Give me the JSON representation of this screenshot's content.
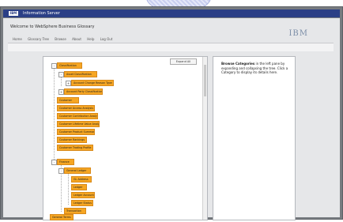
{
  "window": {
    "title": "Information Server",
    "logo": "IBM"
  },
  "header": {
    "welcome": "Welcome to WebSphere Business Glossary",
    "brand": "IBM"
  },
  "nav": {
    "items": [
      "Home",
      "Glossary Tree",
      "Browse",
      "About",
      "Help",
      "Log Out"
    ]
  },
  "tree": {
    "expand_all_label": "Expand All",
    "nodes": [
      {
        "label": "Classification",
        "expander": "-"
      },
      {
        "label": "Asset Classification",
        "expander": "-"
      },
      {
        "label": "Account Change Reason Type",
        "expander": "+"
      },
      {
        "label": "Account Party Classification",
        "expander": "+"
      },
      {
        "label": "Customer",
        "expander": ""
      },
      {
        "label": "Customer Access Analysis",
        "expander": ""
      },
      {
        "label": "Customer Contribution Analysis",
        "expander": ""
      },
      {
        "label": "Customer Lifetime Value Analysis",
        "expander": ""
      },
      {
        "label": "Customer Product Summary",
        "expander": ""
      },
      {
        "label": "Customer Rankings",
        "expander": ""
      },
      {
        "label": "Customer Trading Profile",
        "expander": ""
      },
      {
        "label": "Finance",
        "expander": "-"
      },
      {
        "label": "General Ledger",
        "expander": "-"
      },
      {
        "label": "GL Address",
        "expander": ""
      },
      {
        "label": "Ledger",
        "expander": ""
      },
      {
        "label": "Ledger Account",
        "expander": ""
      },
      {
        "label": "Ledger Status",
        "expander": ""
      },
      {
        "label": "Transaction",
        "expander": ""
      },
      {
        "label": "General Terms",
        "expander": ""
      }
    ]
  },
  "info": {
    "heading": "Browse Categories",
    "body": " in the left pane by expanding and collapsing the tree. Click a Category to display its details here."
  }
}
